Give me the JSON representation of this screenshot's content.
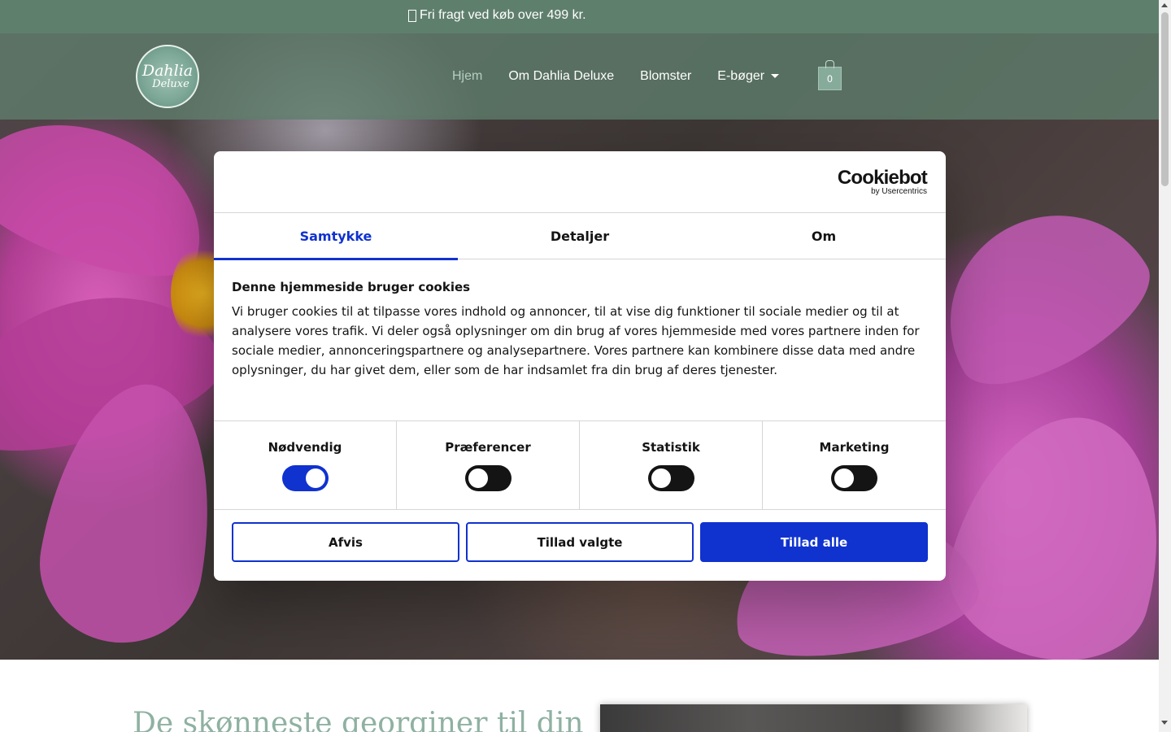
{
  "topbar": {
    "shipping_text": "Fri fragt ved køb over 499 kr."
  },
  "header": {
    "logo": {
      "line1": "Dahlia",
      "line2": "Deluxe"
    },
    "nav": [
      {
        "label": "Hjem",
        "active": true
      },
      {
        "label": "Om Dahlia Deluxe"
      },
      {
        "label": "Blomster"
      },
      {
        "label": "E-bøger",
        "has_dropdown": true
      }
    ],
    "cart_count": "0"
  },
  "content": {
    "headline": "De skønneste georginer til din"
  },
  "cookie_dialog": {
    "brand": {
      "name": "Cookiebot",
      "sub": "by Usercentrics"
    },
    "tabs": [
      {
        "label": "Samtykke",
        "active": true
      },
      {
        "label": "Detaljer"
      },
      {
        "label": "Om"
      }
    ],
    "title": "Denne hjemmeside bruger cookies",
    "body": "Vi bruger cookies til at tilpasse vores indhold og annoncer, til at vise dig funktioner til sociale medier og til at analysere vores trafik. Vi deler også oplysninger om din brug af vores hjemmeside med vores partnere inden for sociale medier, annonceringspartnere og analysepartnere. Vores partnere kan kombinere disse data med andre oplysninger, du har givet dem, eller som de har indsamlet fra din brug af deres tjenester.",
    "categories": [
      {
        "label": "Nødvendig",
        "enabled": true
      },
      {
        "label": "Præferencer",
        "enabled": false
      },
      {
        "label": "Statistik",
        "enabled": false
      },
      {
        "label": "Marketing",
        "enabled": false
      }
    ],
    "buttons": {
      "deny": "Afvis",
      "allow_selected": "Tillad valgte",
      "allow_all": "Tillad alle"
    }
  },
  "colors": {
    "topbar_bg": "#5f7f6d",
    "accent_blue": "#1032cf",
    "headline_green": "#8fb1a2"
  }
}
